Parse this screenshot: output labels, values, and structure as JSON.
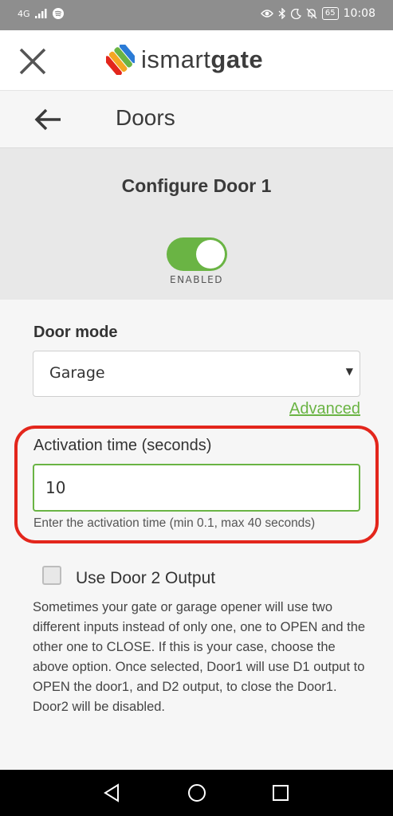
{
  "status_bar": {
    "network": "4G",
    "battery": "65",
    "time": "10:08",
    "icons": [
      "signal-icon",
      "spotify-icon",
      "eye-icon",
      "bluetooth-icon",
      "moon-icon",
      "bell-off-icon",
      "battery-icon"
    ]
  },
  "header": {
    "logo_prefix": "ismart",
    "logo_suffix": "gate",
    "logo_colors": [
      "#e3261c",
      "#f5a623",
      "#6ab444",
      "#2b7bd6"
    ]
  },
  "title_bar": {
    "title": "Doors"
  },
  "config": {
    "title": "Configure Door 1",
    "toggle_state": true,
    "toggle_label": "ENABLED"
  },
  "form": {
    "door_mode_label": "Door mode",
    "door_mode_value": "Garage",
    "advanced_link": "Advanced",
    "activation_label": "Activation time (seconds)",
    "activation_value": "10",
    "activation_help": "Enter the activation time (min 0.1, max 40 seconds)",
    "checkbox_checked": false,
    "checkbox_label": "Use Door 2 Output",
    "description": "Sometimes your gate or garage opener will use two different inputs instead of only one, one to OPEN and the other one to CLOSE. If this is your case, choose the above option. Once selected, Door1 will use D1 output to OPEN the door1, and D2 output, to close the Door1. Door2 will be disabled."
  },
  "colors": {
    "accent_green": "#6ab444",
    "highlight_red": "#e3261c"
  }
}
